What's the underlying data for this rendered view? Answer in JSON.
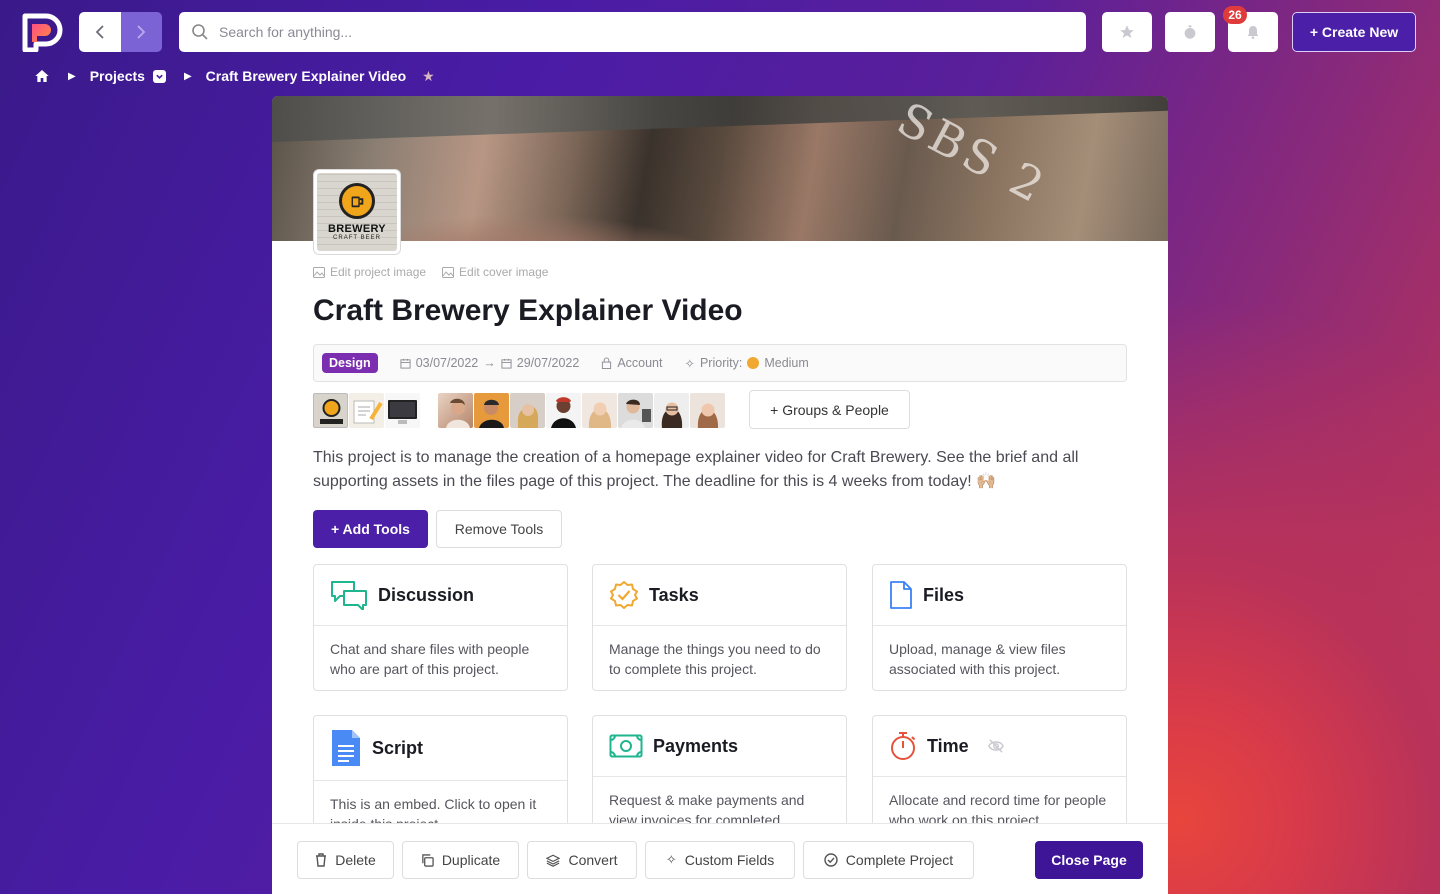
{
  "topbar": {
    "search_placeholder": "Search for anything...",
    "notification_count": "26",
    "create_label": "+ Create New"
  },
  "breadcrumb": {
    "items": [
      "Projects",
      "Craft Brewery Explainer Video"
    ]
  },
  "project": {
    "logo_text": "BREWERY",
    "logo_sub": "CRAFT BEER",
    "cover_chalk": "SBS 2",
    "edit_project_image": "Edit project image",
    "edit_cover_image": "Edit cover image",
    "title": "Craft Brewery Explainer Video",
    "tag": "Design",
    "start_date": "03/07/2022",
    "end_date": "29/07/2022",
    "account": "Account",
    "priority_label": "Priority:",
    "priority_value": "Medium",
    "priority_color": "#f0a830",
    "groups_button": "+ Groups & People",
    "description": "This project is to manage the creation of a homepage explainer video for Craft Brewery. See the brief and all supporting assets in the files page of this project. The deadline for this is 4 weeks from today! 🙌🏼"
  },
  "tools_actions": {
    "add": "+ Add Tools",
    "remove": "Remove Tools"
  },
  "tools": [
    {
      "title": "Discussion",
      "icon": "chat-bubbles-icon",
      "desc": "Chat and share files with people who are part of this project."
    },
    {
      "title": "Tasks",
      "icon": "check-badge-icon",
      "desc": "Manage the things you need to do to complete this project."
    },
    {
      "title": "Files",
      "icon": "file-icon",
      "desc": "Upload, manage & view files associated with this project."
    },
    {
      "title": "Script",
      "icon": "google-doc-icon",
      "desc": "This is an embed. Click to open it inside this project."
    },
    {
      "title": "Payments",
      "icon": "banknote-icon",
      "desc": "Request & make payments and view invoices for completed..."
    },
    {
      "title": "Time",
      "icon": "stopwatch-icon",
      "desc": "Allocate and record time for people who work on this project."
    }
  ],
  "bottom_bar": {
    "delete": "Delete",
    "duplicate": "Duplicate",
    "convert": "Convert",
    "custom_fields": "Custom Fields",
    "complete": "Complete Project",
    "close": "Close Page"
  },
  "colors": {
    "brand": "#4b1fa8",
    "tag": "#7b2fb0",
    "badge": "#e03b3b"
  }
}
